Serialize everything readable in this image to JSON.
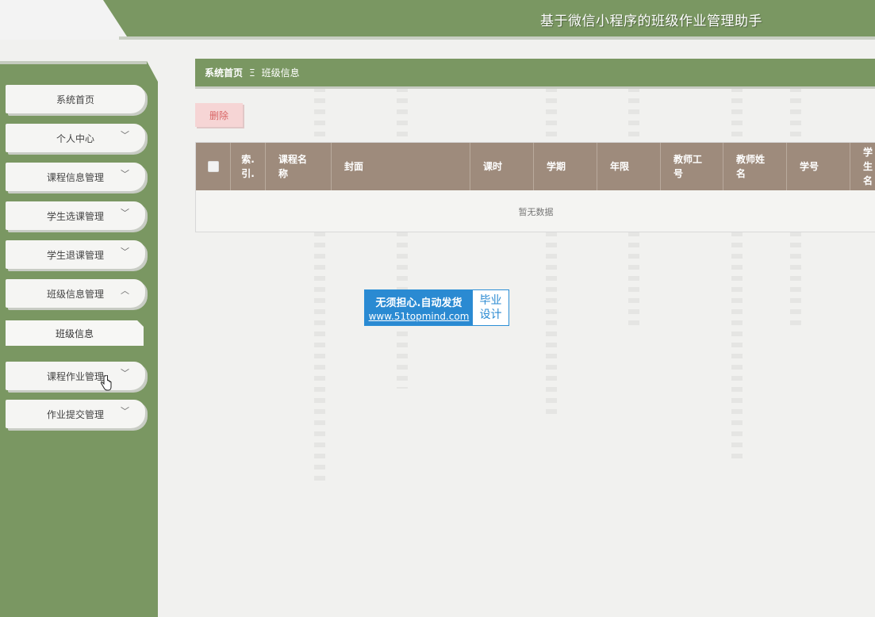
{
  "header": {
    "title": "基于微信小程序的班级作业管理助手"
  },
  "sidebar": {
    "items": [
      {
        "label": "系统首页",
        "chevron": ""
      },
      {
        "label": "个人中心",
        "chevron": "down"
      },
      {
        "label": "课程信息管理",
        "chevron": "down"
      },
      {
        "label": "学生选课管理",
        "chevron": "down"
      },
      {
        "label": "学生退课管理",
        "chevron": "down"
      },
      {
        "label": "班级信息管理",
        "chevron": "up"
      },
      {
        "label": "课程作业管理",
        "chevron": "down"
      },
      {
        "label": "作业提交管理",
        "chevron": "down"
      }
    ],
    "sub_item": {
      "label": "班级信息"
    },
    "chevron_down_glyph": "﹀",
    "chevron_up_glyph": "︿"
  },
  "breadcrumb": {
    "home": "系统首页",
    "separator": "Ξ",
    "current": "班级信息"
  },
  "toolbar": {
    "delete_label": "删除"
  },
  "table": {
    "columns": [
      "索.\n引.",
      "课程名\n称",
      "封面",
      "课时",
      "学期",
      "年限",
      "教师工\n号",
      "教师姓\n名",
      "学号",
      "学生\n名"
    ],
    "empty_text": "暂无数据"
  },
  "watermark": {
    "slogan": "无须担心.自动发货",
    "url": "www.51topmind.com",
    "tag_line1": "毕业",
    "tag_line2": "设计"
  },
  "colors": {
    "primary_green": "#7a9762",
    "table_header": "#9e8b7c",
    "delete_bg": "#f6d5d5",
    "delete_text": "#d96565"
  }
}
